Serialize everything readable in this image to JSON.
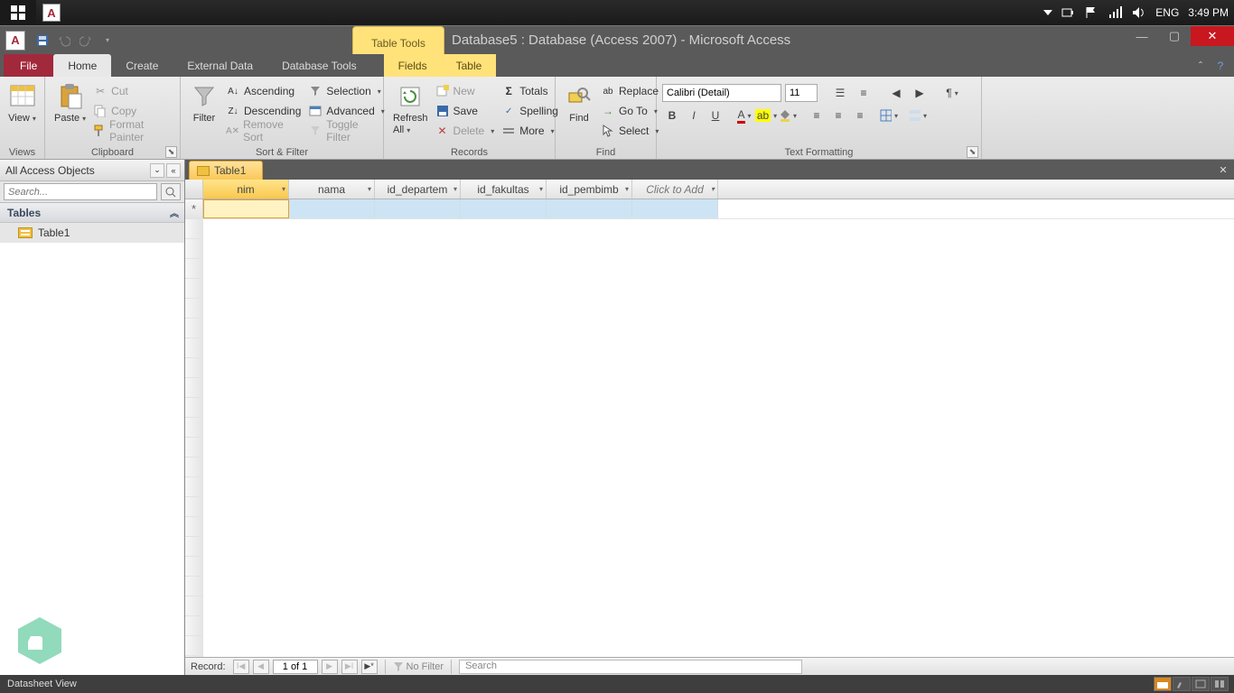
{
  "systray": {
    "lang": "ENG",
    "clock": "3:49 PM"
  },
  "window": {
    "title": "Database5 : Database (Access 2007)  -  Microsoft Access",
    "context_tab": "Table Tools"
  },
  "tabs": {
    "file": "File",
    "home": "Home",
    "create": "Create",
    "external_data": "External Data",
    "database_tools": "Database Tools",
    "fields": "Fields",
    "table": "Table"
  },
  "ribbon": {
    "views": {
      "view": "View",
      "group": "Views"
    },
    "clipboard": {
      "paste": "Paste",
      "cut": "Cut",
      "copy": "Copy",
      "format_painter": "Format Painter",
      "group": "Clipboard"
    },
    "sort": {
      "filter": "Filter",
      "ascending": "Ascending",
      "descending": "Descending",
      "remove_sort": "Remove Sort",
      "selection": "Selection",
      "advanced": "Advanced",
      "toggle_filter": "Toggle Filter",
      "group": "Sort & Filter"
    },
    "records": {
      "refresh": "Refresh\nAll",
      "new": "New",
      "save": "Save",
      "delete": "Delete",
      "totals": "Totals",
      "spelling": "Spelling",
      "more": "More",
      "group": "Records"
    },
    "find": {
      "find": "Find",
      "replace": "Replace",
      "goto": "Go To",
      "select": "Select",
      "group": "Find"
    },
    "text_fmt": {
      "font": "Calibri (Detail)",
      "size": "11",
      "group": "Text Formatting"
    }
  },
  "nav": {
    "header": "All Access Objects",
    "search_placeholder": "Search...",
    "category": "Tables",
    "items": [
      "Table1"
    ]
  },
  "doc": {
    "tab": "Table1",
    "columns": [
      "nim",
      "nama",
      "id_departemen",
      "id_fakultas",
      "id_pembimbing"
    ],
    "display_columns": [
      "nim",
      "nama",
      "id_departem",
      "id_fakultas",
      "id_pembimb"
    ],
    "add_column": "Click to Add"
  },
  "recnav": {
    "label": "Record:",
    "pos": "1 of 1",
    "no_filter": "No Filter",
    "search": "Search"
  },
  "status": {
    "text": "Datasheet View"
  }
}
